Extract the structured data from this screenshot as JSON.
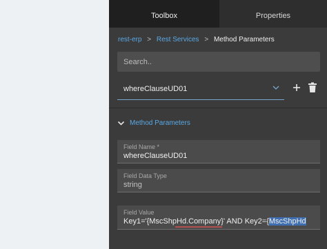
{
  "tabs": [
    {
      "label": "Toolbox"
    },
    {
      "label": "Properties"
    }
  ],
  "breadcrumb": {
    "items": [
      "rest-erp",
      "Rest Services",
      "Method Parameters"
    ],
    "separator": ">"
  },
  "search": {
    "placeholder": "Search..",
    "value": ""
  },
  "method_select": {
    "selected": "whereClauseUD01"
  },
  "section": {
    "title": "Method Parameters",
    "expanded": true
  },
  "fields": {
    "field_name": {
      "label": "Field Name *",
      "value": "whereClauseUD01"
    },
    "field_data_type": {
      "label": "Field Data Type",
      "value": "string"
    },
    "field_value": {
      "label": "Field Value",
      "value_before_selection": "Key1='{MscShpHd.Company}' AND Key2={",
      "value_selected": "MscShpHd"
    }
  },
  "icons": {
    "chevron": "chevron-down-icon",
    "add": "plus-icon",
    "delete": "trash-icon",
    "section": "chevron-down-icon"
  },
  "colors": {
    "panel_bg": "#3b3b3b",
    "accent": "#5aa9e6",
    "selection": "#3f6fb0",
    "spellcheck": "#d9534f"
  }
}
